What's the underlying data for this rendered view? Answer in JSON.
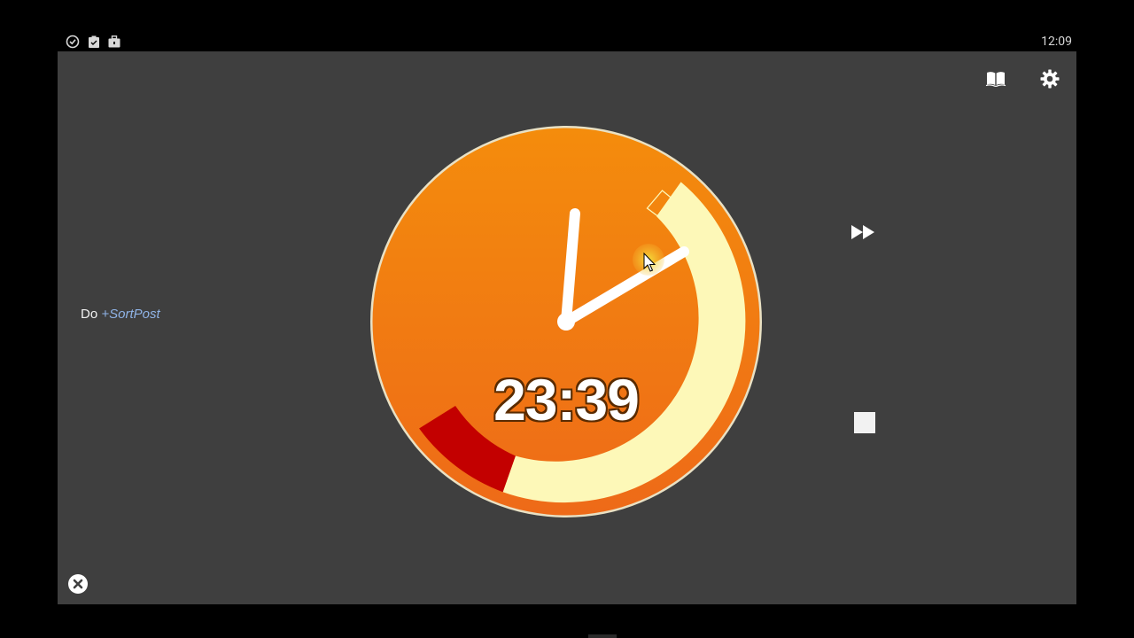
{
  "status_bar": {
    "time": "12:09",
    "icons": [
      "clock-notification-icon",
      "clipboard-check-icon",
      "briefcase-icon"
    ]
  },
  "toolbar": {
    "icons": [
      "book-icon",
      "gear-icon"
    ]
  },
  "task": {
    "prefix": "Do",
    "tags": "+SortPost"
  },
  "timer": {
    "remaining": "23:39",
    "face_color": "#f27a0f",
    "elapsed_color": "#fdf8b8",
    "overrun_color": "#c30000"
  },
  "controls": {
    "icons": [
      "fast-forward-icon",
      "stop-icon",
      "close-icon"
    ]
  }
}
